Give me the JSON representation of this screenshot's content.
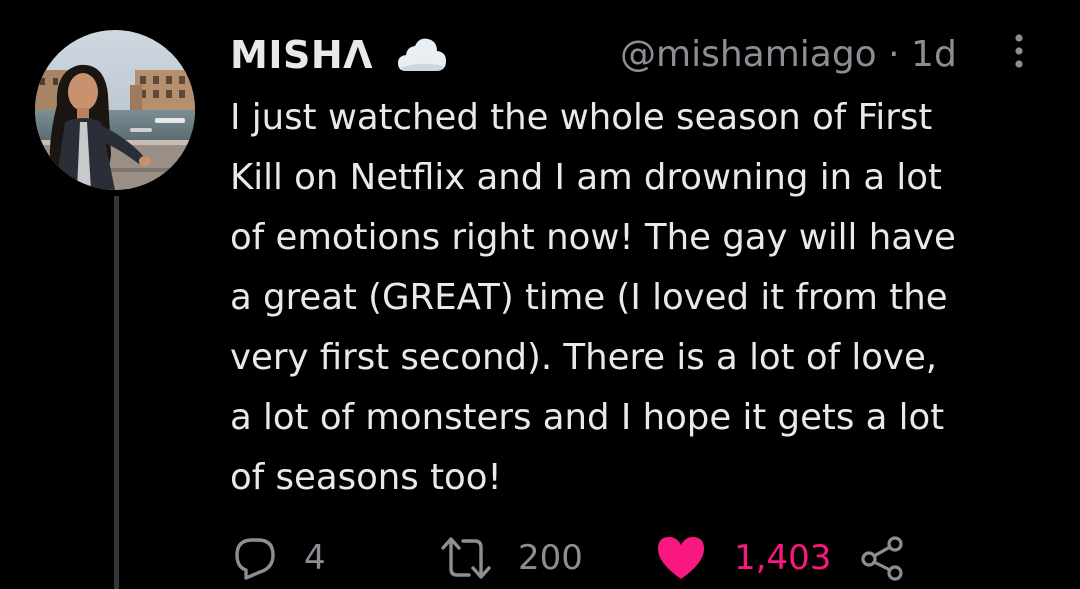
{
  "tweet": {
    "display_name": "MISHΛ",
    "handle_time": "@mishamiago · 1d",
    "text": "I just watched the whole season of First\nKill on Netflix and I am drowning in a lot\nof emotions right now! The gay will have\na great (GREAT) time (I loved it from the\nvery first second). There is a lot of love,\na lot of monsters and I hope it gets a lot\nof seasons too!",
    "badge_icon": "cloud-icon",
    "actions": {
      "reply_count": "4",
      "retweet_count": "200",
      "like_count": "1,403"
    }
  },
  "colors": {
    "background": "#000000",
    "text_primary": "#e7e9ea",
    "text_secondary": "#8b8f94",
    "like_pink": "#f91880",
    "thread_line": "#333639"
  }
}
